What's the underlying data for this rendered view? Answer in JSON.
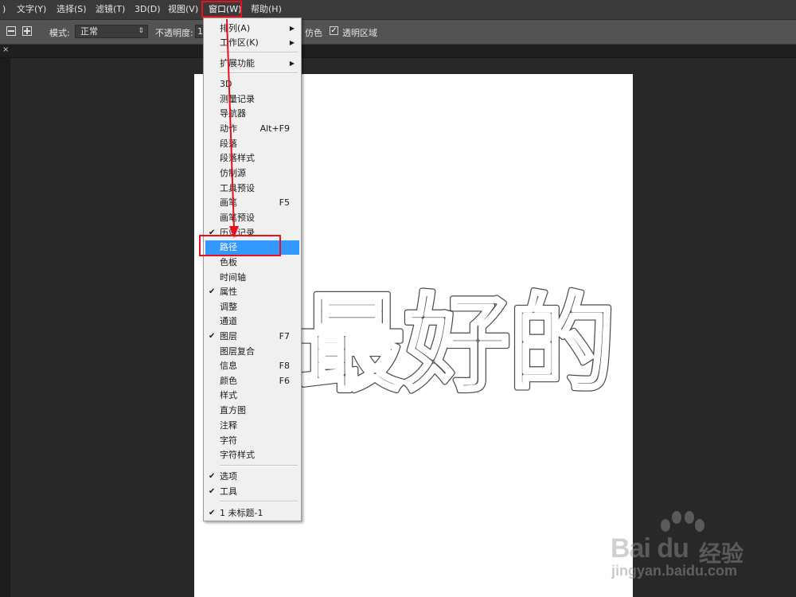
{
  "menubar": {
    "items": [
      {
        "label": ")"
      },
      {
        "label": "文字(Y)"
      },
      {
        "label": "选择(S)"
      },
      {
        "label": "滤镜(T)"
      },
      {
        "label": "3D(D)"
      },
      {
        "label": "视图(V)"
      },
      {
        "label": "窗口(W)"
      },
      {
        "label": "帮助(H)"
      }
    ]
  },
  "options": {
    "mode_label": "模式:",
    "mode_value": "正常",
    "opacity_label": "不透明度:",
    "opacity_value": "1",
    "imitate_label": "仿色",
    "transparency_label": "透明区域"
  },
  "tabbar": {
    "close_glyph": "×"
  },
  "window_menu": {
    "items": [
      {
        "label": "排列(A)",
        "shortcut": "",
        "check": false,
        "submenu": true
      },
      {
        "label": "工作区(K)",
        "shortcut": "",
        "check": false,
        "submenu": true
      },
      {
        "label": "扩展功能",
        "shortcut": "",
        "check": false,
        "submenu": true
      },
      {
        "label": "3D",
        "shortcut": "",
        "check": false
      },
      {
        "label": "测量记录",
        "shortcut": "",
        "check": false
      },
      {
        "label": "导航器",
        "shortcut": "",
        "check": false
      },
      {
        "label": "动作",
        "shortcut": "Alt+F9",
        "check": false
      },
      {
        "label": "段落",
        "shortcut": "",
        "check": false
      },
      {
        "label": "段落样式",
        "shortcut": "",
        "check": false
      },
      {
        "label": "仿制源",
        "shortcut": "",
        "check": false
      },
      {
        "label": "工具预设",
        "shortcut": "",
        "check": false
      },
      {
        "label": "画笔",
        "shortcut": "F5",
        "check": false
      },
      {
        "label": "画笔预设",
        "shortcut": "",
        "check": false
      },
      {
        "label": "历史记录",
        "shortcut": "",
        "check": true
      },
      {
        "label": "路径",
        "shortcut": "",
        "check": false,
        "selected": true
      },
      {
        "label": "色板",
        "shortcut": "",
        "check": false
      },
      {
        "label": "时间轴",
        "shortcut": "",
        "check": false
      },
      {
        "label": "属性",
        "shortcut": "",
        "check": true
      },
      {
        "label": "调整",
        "shortcut": "",
        "check": false
      },
      {
        "label": "通道",
        "shortcut": "",
        "check": false
      },
      {
        "label": "图层",
        "shortcut": "F7",
        "check": true
      },
      {
        "label": "图层复合",
        "shortcut": "",
        "check": false
      },
      {
        "label": "信息",
        "shortcut": "F8",
        "check": false
      },
      {
        "label": "颜色",
        "shortcut": "F6",
        "check": false
      },
      {
        "label": "样式",
        "shortcut": "",
        "check": false
      },
      {
        "label": "直方图",
        "shortcut": "",
        "check": false
      },
      {
        "label": "注释",
        "shortcut": "",
        "check": false
      },
      {
        "label": "字符",
        "shortcut": "",
        "check": false
      },
      {
        "label": "字符样式",
        "shortcut": "",
        "check": false
      },
      {
        "label": "选项",
        "shortcut": "",
        "check": true
      },
      {
        "label": "工具",
        "shortcut": "",
        "check": true
      },
      {
        "label": "1 未标题-1",
        "shortcut": "",
        "check": true
      }
    ]
  },
  "canvas_text": "最好的",
  "watermark": {
    "logo": "Bai du",
    "cn": "经验",
    "url": "jingyan.baidu.com"
  },
  "colors": {
    "highlight_red": "#e8101e",
    "selection_blue": "#3399ff",
    "menubar_bg": "#3a3a3a",
    "optbar_bg": "#535353",
    "workspace_bg": "#282828"
  },
  "icons": {
    "check": "checkmark-icon",
    "submenu": "submenu-arrow-icon"
  }
}
